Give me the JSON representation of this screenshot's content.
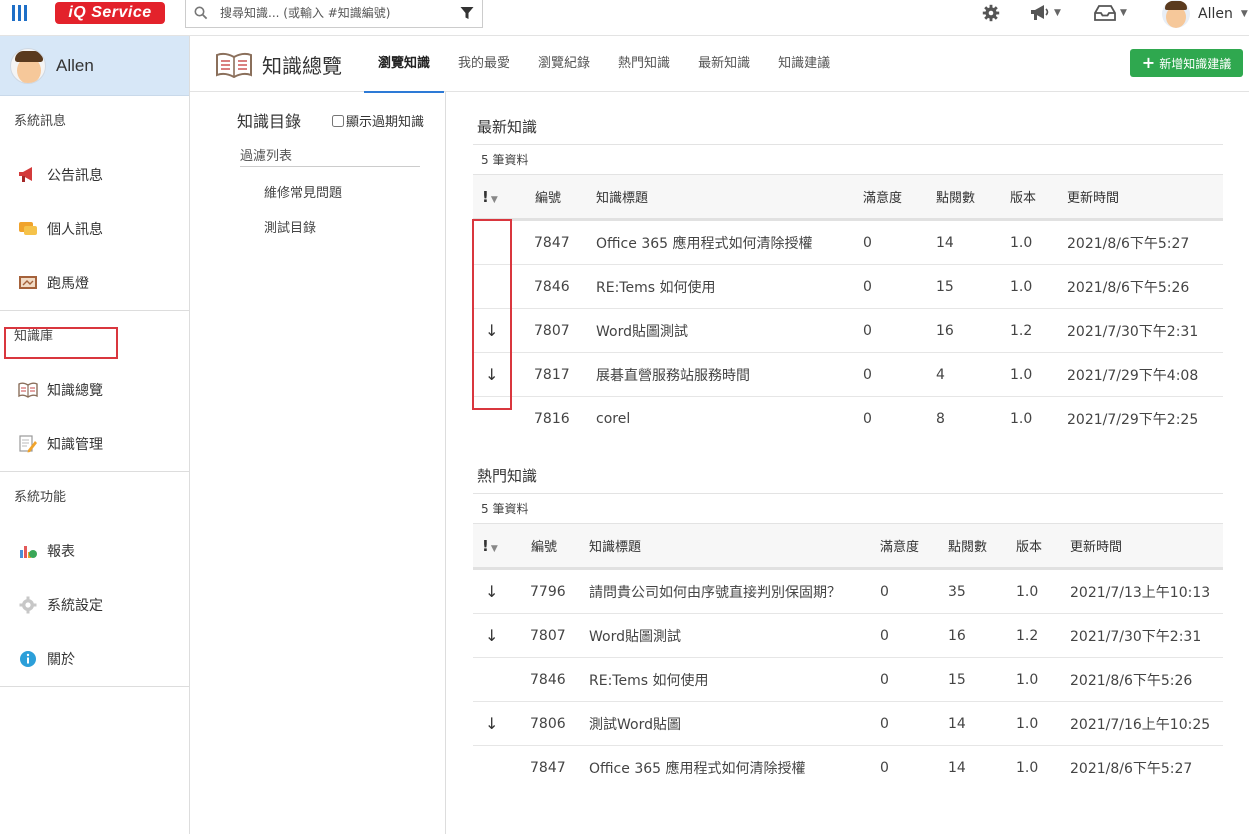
{
  "app": {
    "logo_text": "iQ Service",
    "search_placeholder": "搜尋知識... (或輸入 #知識編號)",
    "user_name": "Allen"
  },
  "sidebar": {
    "profile_name": "Allen",
    "sections": [
      {
        "title": "系統訊息",
        "items": [
          "公告訊息",
          "個人訊息",
          "跑馬燈"
        ]
      },
      {
        "title": "知識庫",
        "items": [
          "知識總覽",
          "知識管理"
        ]
      },
      {
        "title": "系統功能",
        "items": [
          "報表",
          "系統設定",
          "關於"
        ]
      }
    ],
    "active_item": "知識總覽"
  },
  "header": {
    "title": "知識總覽",
    "tabs": [
      "瀏覽知識",
      "我的最愛",
      "瀏覽紀錄",
      "熱門知識",
      "最新知識",
      "知識建議"
    ],
    "active_tab": "瀏覽知識",
    "add_button": "新增知識建議"
  },
  "catalog": {
    "title": "知識目錄",
    "show_expired_label": "顯示過期知識",
    "filter_label": "過濾列表",
    "items": [
      "維修常見問題",
      "測試目錄"
    ]
  },
  "latest": {
    "title": "最新知識",
    "count_text": "5 筆資料",
    "columns": [
      "!",
      "編號",
      "知識標題",
      "滿意度",
      "點閱數",
      "版本",
      "更新時間"
    ],
    "rows": [
      {
        "flag": "",
        "id": "7847",
        "title": "Office 365 應用程式如何清除授權",
        "satisfaction": "0",
        "views": "14",
        "version": "1.0",
        "updated": "2021/8/6下午5:27"
      },
      {
        "flag": "",
        "id": "7846",
        "title": "RE:Tems 如何使用",
        "satisfaction": "0",
        "views": "15",
        "version": "1.0",
        "updated": "2021/8/6下午5:26"
      },
      {
        "flag": "↓",
        "id": "7807",
        "title": "Word貼圖測試",
        "satisfaction": "0",
        "views": "16",
        "version": "1.2",
        "updated": "2021/7/30下午2:31"
      },
      {
        "flag": "↓",
        "id": "7817",
        "title": "展碁直營服務站服務時間",
        "satisfaction": "0",
        "views": "4",
        "version": "1.0",
        "updated": "2021/7/29下午4:08"
      },
      {
        "flag": "",
        "id": "7816",
        "title": "corel",
        "satisfaction": "0",
        "views": "8",
        "version": "1.0",
        "updated": "2021/7/29下午2:25"
      }
    ]
  },
  "popular": {
    "title": "熱門知識",
    "count_text": "5 筆資料",
    "columns": [
      "!",
      "編號",
      "知識標題",
      "滿意度",
      "點閱數",
      "版本",
      "更新時間"
    ],
    "rows": [
      {
        "flag": "↓",
        "id": "7796",
        "title": "請問貴公司如何由序號直接判別保固期？",
        "satisfaction": "0",
        "views": "35",
        "version": "1.0",
        "updated": "2021/7/13上午10:13"
      },
      {
        "flag": "↓",
        "id": "7807",
        "title": "Word貼圖測試",
        "satisfaction": "0",
        "views": "16",
        "version": "1.2",
        "updated": "2021/7/30下午2:31"
      },
      {
        "flag": "",
        "id": "7846",
        "title": "RE:Tems 如何使用",
        "satisfaction": "0",
        "views": "15",
        "version": "1.0",
        "updated": "2021/8/6下午5:26"
      },
      {
        "flag": "↓",
        "id": "7806",
        "title": "測試Word貼圖",
        "satisfaction": "0",
        "views": "14",
        "version": "1.0",
        "updated": "2021/7/16上午10:25"
      },
      {
        "flag": "",
        "id": "7847",
        "title": "Office 365 應用程式如何清除授權",
        "satisfaction": "0",
        "views": "14",
        "version": "1.0",
        "updated": "2021/8/6下午5:27"
      }
    ]
  },
  "colors": {
    "brand_red": "#e3222b",
    "accent_blue": "#2d7ad6",
    "add_green": "#2fa84f",
    "highlight_red": "#d9363e"
  }
}
